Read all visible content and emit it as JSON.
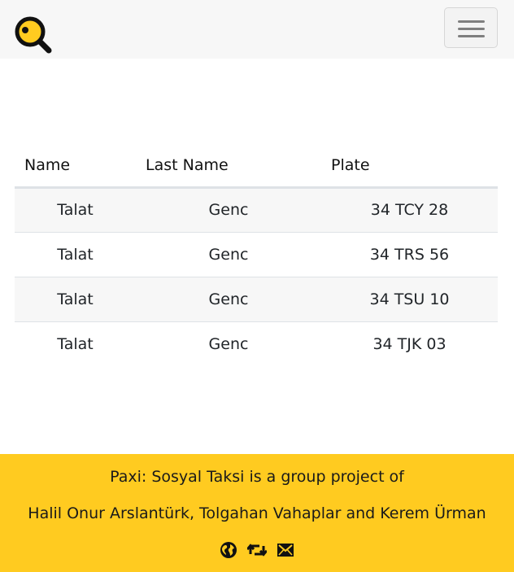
{
  "header": {
    "logo_icon": "magnifier-logo-icon",
    "menu_icon": "hamburger-menu-icon"
  },
  "table": {
    "headers": [
      "Name",
      "Last Name",
      "Plate"
    ],
    "rows": [
      [
        "Talat",
        "Genc",
        "34 TCY 28"
      ],
      [
        "Talat",
        "Genc",
        "34 TRS 56"
      ],
      [
        "Talat",
        "Genc",
        "34 TSU 10"
      ],
      [
        "Talat",
        "Genc",
        "34 TJK 03"
      ]
    ]
  },
  "footer": {
    "line1": "Paxi: Sosyal Taksi is a group project of",
    "line2": "Halil Onur Arslantürk, Tolgahan Vahaplar and Kerem Ürman",
    "icons": [
      "globe-icon",
      "retweet-icon",
      "envelope-icon"
    ]
  },
  "colors": {
    "accent": "#ffcb20",
    "navbar_bg": "#f7f7f7",
    "stripe": "#f7f7f7",
    "border": "#dee2e6"
  }
}
